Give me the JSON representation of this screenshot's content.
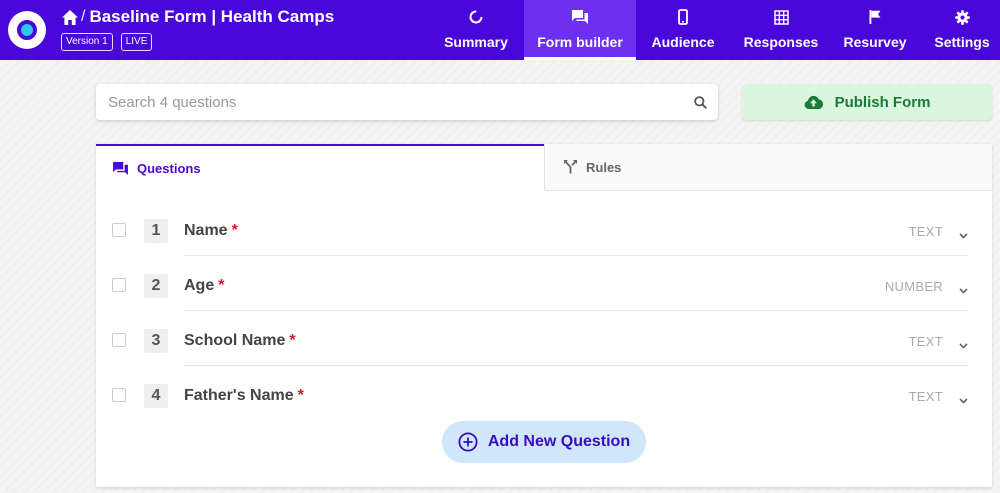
{
  "header": {
    "title": "Baseline Form | Health Camps",
    "breadcrumb_separator": "/",
    "version_badge": "Version 1",
    "status_badge": "LIVE",
    "nav": [
      {
        "label": "Summary",
        "icon": "loading-circle-icon",
        "active": false
      },
      {
        "label": "Form builder",
        "icon": "forum-icon",
        "active": true
      },
      {
        "label": "Audience",
        "icon": "phone-icon",
        "active": false
      },
      {
        "label": "Responses",
        "icon": "grid-icon",
        "active": false
      },
      {
        "label": "Resurvey",
        "icon": "flag-icon",
        "active": false
      },
      {
        "label": "Settings",
        "icon": "gear-icon",
        "active": false
      }
    ]
  },
  "search": {
    "placeholder": "Search 4 questions"
  },
  "publish": {
    "label": "Publish Form"
  },
  "tabs": {
    "questions": "Questions",
    "rules": "Rules"
  },
  "questions": [
    {
      "number": "1",
      "name": "Name",
      "required_mark": "*",
      "type": "TEXT"
    },
    {
      "number": "2",
      "name": "Age",
      "required_mark": "*",
      "type": "NUMBER"
    },
    {
      "number": "3",
      "name": "School Name",
      "required_mark": "*",
      "type": "TEXT"
    },
    {
      "number": "4",
      "name": "Father's Name",
      "required_mark": "*",
      "type": "TEXT"
    }
  ],
  "add_question": {
    "label": "Add New Question"
  },
  "colors": {
    "brand": "#4a07d9",
    "active_tab_bg": "#6d2ff0",
    "publish_bg": "#d9f7df",
    "publish_text": "#1b7a35",
    "required": "#d11a2a",
    "add_bg": "#cfe6fb"
  }
}
